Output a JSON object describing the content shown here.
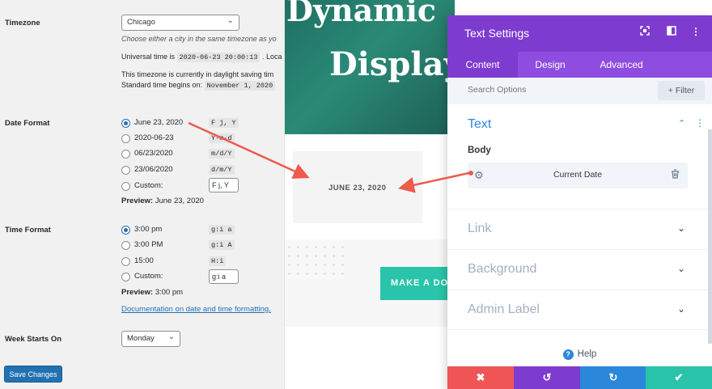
{
  "wp_settings": {
    "timezone": {
      "label": "Timezone",
      "value": "Chicago",
      "desc": "Choose either a city in the same timezone as yo",
      "utc_prefix": "Universal time is",
      "utc_value": "2020-06-23 20:00:13",
      "utc_suffix": ". Loca",
      "dst_line": "This timezone is currently in daylight saving tim",
      "std_prefix": "Standard time begins on:",
      "std_value": "November 1, 2020"
    },
    "date_format": {
      "label": "Date Format",
      "options": [
        {
          "label": "June 23, 2020",
          "format": "F j, Y",
          "checked": true
        },
        {
          "label": "2020-06-23",
          "format": "Y-m-d",
          "checked": false
        },
        {
          "label": "06/23/2020",
          "format": "m/d/Y",
          "checked": false
        },
        {
          "label": "23/06/2020",
          "format": "d/m/Y",
          "checked": false
        }
      ],
      "custom_label": "Custom:",
      "custom_value": "F j, Y",
      "preview_label": "Preview:",
      "preview_value": "June 23, 2020"
    },
    "time_format": {
      "label": "Time Format",
      "options": [
        {
          "label": "3:00 pm",
          "format": "g:i a",
          "checked": true
        },
        {
          "label": "3:00 PM",
          "format": "g:i A",
          "checked": false
        },
        {
          "label": "15:00",
          "format": "H:i",
          "checked": false
        }
      ],
      "custom_label": "Custom:",
      "custom_value": "g:i a",
      "preview_label": "Preview:",
      "preview_value": "3:00 pm"
    },
    "doc_link": "Documentation on date and time formatting",
    "doc_link_suffix": ".",
    "week_starts": {
      "label": "Week Starts On",
      "value": "Monday"
    },
    "save_label": "Save Changes"
  },
  "preview": {
    "hero_line1": "Dynamic",
    "hero_line2": "Display",
    "date_text": "JUNE 23, 2020",
    "cta_text": "MAKE A DO"
  },
  "panel": {
    "title": "Text Settings",
    "tabs": [
      "Content",
      "Design",
      "Advanced"
    ],
    "active_tab": "Content",
    "search_placeholder": "Search Options",
    "filter_label": "Filter",
    "section_title": "Text",
    "body_label": "Body",
    "dynamic_value": "Current Date",
    "accordions": [
      "Link",
      "Background",
      "Admin Label"
    ],
    "help_label": "Help",
    "colors": {
      "header": "#7e3bd0",
      "tabs": "#8e4ce0",
      "cancel": "#ef5555",
      "undo": "#7e3bd0",
      "redo": "#2b87da",
      "save": "#29c4a9"
    }
  },
  "icons": [
    "expand-icon",
    "columns-icon",
    "more-vertical-icon",
    "gear-icon",
    "trash-icon",
    "help-icon",
    "close-icon",
    "undo-icon",
    "redo-icon",
    "check-icon"
  ]
}
